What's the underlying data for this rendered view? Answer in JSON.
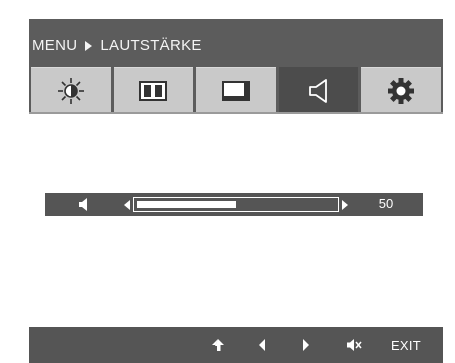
{
  "header": {
    "menu_label": "MENU",
    "section_label": "LAUTSTÄRKE",
    "background": "#5c5c5c"
  },
  "tabs": [
    {
      "icon": "brightness-icon",
      "active": false
    },
    {
      "icon": "picture-icon",
      "active": false
    },
    {
      "icon": "image-position-icon",
      "active": false
    },
    {
      "icon": "volume-icon",
      "active": true
    },
    {
      "icon": "settings-gear-icon",
      "active": false
    }
  ],
  "volume": {
    "icon": "speaker-icon",
    "value_label": "50",
    "level_fraction": 0.5
  },
  "footer": {
    "buttons": [
      {
        "icon": "up-arrow-icon"
      },
      {
        "icon": "left-arrow-icon"
      },
      {
        "icon": "right-arrow-icon"
      },
      {
        "icon": "mute-icon"
      }
    ],
    "exit_label": "EXIT"
  },
  "colors": {
    "frame": "#5c5c5c",
    "tab": "#c9c9c9",
    "tab_active": "#4c4c4c",
    "row": "#555555",
    "text": "#ffffff"
  }
}
